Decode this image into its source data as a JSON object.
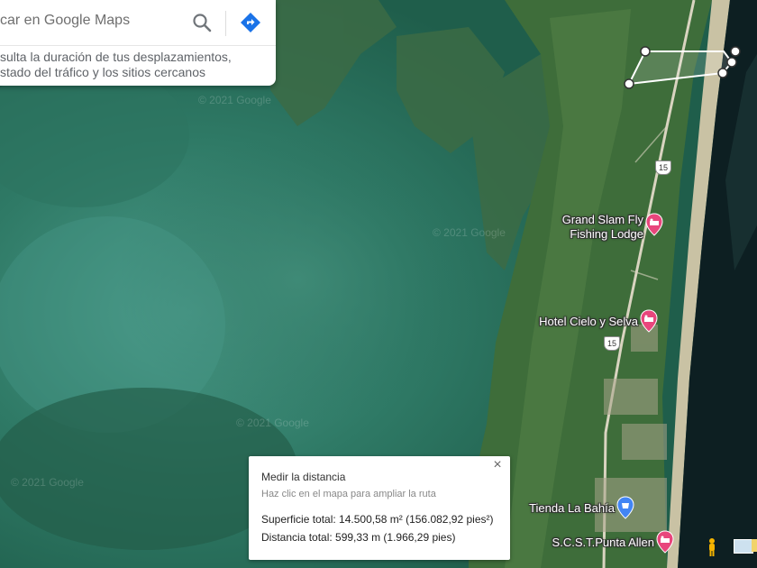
{
  "search": {
    "placeholder": "car en Google Maps",
    "promo_line1": "sulta la duración de tus desplazamientos,",
    "promo_line2": "stado del tráfico y los sitios cercanos"
  },
  "places": [
    {
      "line1": "Grand Slam Fly",
      "line2": "Fishing Lodge"
    },
    {
      "line1": "Hotel Cielo y Selva",
      "line2": ""
    },
    {
      "line1": "Tienda La Bahía",
      "line2": ""
    },
    {
      "line1": "S.C.S.T.Punta Allen",
      "line2": ""
    }
  ],
  "routes": {
    "r1": "15",
    "r2": "15"
  },
  "watermarks": [
    "© 2021 Google",
    "© 2021 Google",
    "© 2021 Google",
    "© 2021 Google"
  ],
  "measure": {
    "title": "Medir la distancia",
    "hint": "Haz clic en el mapa para ampliar la ruta",
    "area": "Superficie total: 14.500,58 m² (156.082,92 pies²)",
    "distance": "Distancia total: 599,33 m (1.966,29 pies)",
    "close": "×"
  },
  "colors": {
    "accent": "#1a73e8",
    "pin": "#e8467c",
    "water": "#1d5a46",
    "sea": "#0d1f22"
  }
}
